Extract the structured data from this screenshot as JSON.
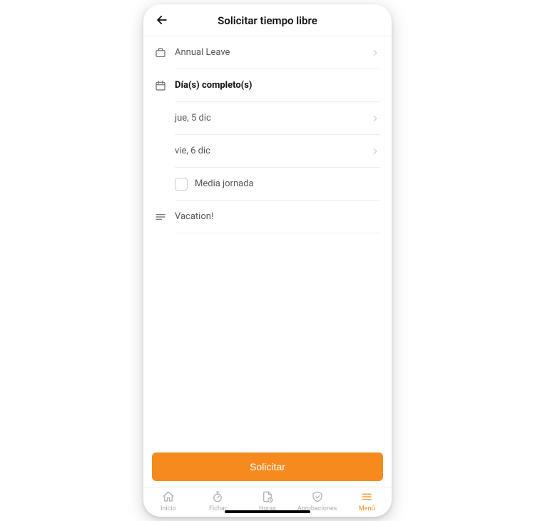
{
  "header": {
    "title": "Solicitar tiempo libre"
  },
  "form": {
    "leave_type": "Annual Leave",
    "duration_mode": "Día(s) completo(s)",
    "start_date": "jue, 5 dic",
    "end_date": "vie, 6 dic",
    "half_day_label": "Media jornada",
    "note": "Vacation!"
  },
  "footer": {
    "submit_label": "Solicitar"
  },
  "tabs": {
    "0": "Inicio",
    "1": "Fichar",
    "2": "Horas",
    "3": "Aprobaciones",
    "4": "Menú"
  },
  "colors": {
    "accent": "#f68a1f"
  }
}
